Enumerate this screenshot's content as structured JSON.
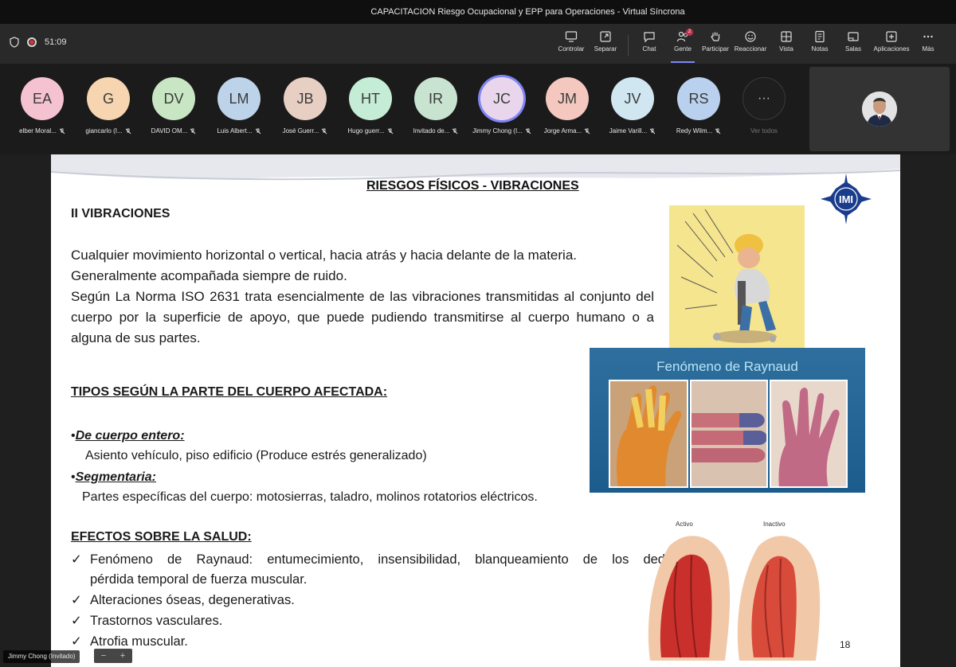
{
  "window": {
    "title": "CAPACITACION Riesgo Ocupacional y EPP para Operaciones - Virtual Síncrona"
  },
  "toolbar": {
    "timer": "51:09",
    "buttons": [
      {
        "label": "Controlar",
        "icon": "share-screen-icon"
      },
      {
        "label": "Separar",
        "icon": "popout-icon"
      },
      {
        "label": "Chat",
        "icon": "chat-icon"
      },
      {
        "label": "Gente",
        "icon": "people-icon",
        "badge": "2"
      },
      {
        "label": "Participar",
        "icon": "raise-hand-icon"
      },
      {
        "label": "Reaccionar",
        "icon": "smiley-icon"
      },
      {
        "label": "Vista",
        "icon": "view-grid-icon"
      },
      {
        "label": "Notas",
        "icon": "notes-icon"
      },
      {
        "label": "Salas",
        "icon": "rooms-icon"
      },
      {
        "label": "Aplicaciones",
        "icon": "add-apps-icon"
      },
      {
        "label": "Más",
        "icon": "more-icon"
      }
    ]
  },
  "participants": [
    {
      "initials": "EA",
      "name": "elber Moral...",
      "color": "#f4c2d0"
    },
    {
      "initials": "G",
      "name": "giancarlo (I...",
      "color": "#f6d5b0"
    },
    {
      "initials": "DV",
      "name": "DAVID OM...",
      "color": "#c9e6c4"
    },
    {
      "initials": "LM",
      "name": "Luis Albert...",
      "color": "#bcd3ea"
    },
    {
      "initials": "JB",
      "name": "José Guerr...",
      "color": "#e8cfc4"
    },
    {
      "initials": "HT",
      "name": "Hugo guerr...",
      "color": "#c5ecd4"
    },
    {
      "initials": "IR",
      "name": "Invitado de...",
      "color": "#c8e3d0"
    },
    {
      "initials": "JC",
      "name": "Jimmy Chong (I...",
      "color": "#ead6ec"
    },
    {
      "initials": "JM",
      "name": "Jorge Arma...",
      "color": "#f4c8bf"
    },
    {
      "initials": "JV",
      "name": "Jaime Varill...",
      "color": "#d0e6f0"
    },
    {
      "initials": "RS",
      "name": "Redy Wilm...",
      "color": "#b9d1ee"
    }
  ],
  "more_participants": {
    "glyph": "···",
    "label": "Ver todos"
  },
  "slide": {
    "title": "RIESGOS FÍSICOS - VIBRACIONES",
    "section1": "II VIBRACIONES",
    "paragraph": [
      "Cualquier movimiento horizontal o vertical, hacia atrás y hacia delante de la materia.",
      "Generalmente acompañada siempre de ruido.",
      "Según La Norma ISO 2631 trata esencialmente de las vibraciones transmitidas al conjunto del cuerpo por la superficie de apoyo, que puede pudiendo transmitirse al cuerpo humano o a alguna de sus partes."
    ],
    "section2": "TIPOS SEGÚN LA PARTE DEL CUERPO AFECTADA:",
    "type1_head": "De cuerpo entero:",
    "type1_text": "Asiento vehículo, piso edificio (Produce estrés  generalizado)",
    "type2_head": "Segmentaria:",
    "type2_text": "Partes específicas del cuerpo: motosierras, taladro, molinos rotatorios eléctricos.",
    "section3": "EFECTOS SOBRE LA SALUD:",
    "effect1_line1": "Fenómeno de Raynaud: entumecimiento, insensibilidad, blanqueamiento de los dedos,",
    "effect1_line2": "pérdida temporal de fuerza muscular.",
    "effect2": "Alteraciones óseas, degenerativas.",
    "effect3": "Trastornos vasculares.",
    "effect4": "Atrofia muscular.",
    "check": "✓",
    "bullet": "•",
    "page_number": "18",
    "logo_text": "IMI",
    "raynaud_title": "Fenómeno de Raynaud",
    "muscle_active": "Activo",
    "muscle_inactive": "Inactivo"
  },
  "presenter_label": "Jimmy Chong (Invitado)",
  "zoom": {
    "minus": "−",
    "plus": "+"
  }
}
